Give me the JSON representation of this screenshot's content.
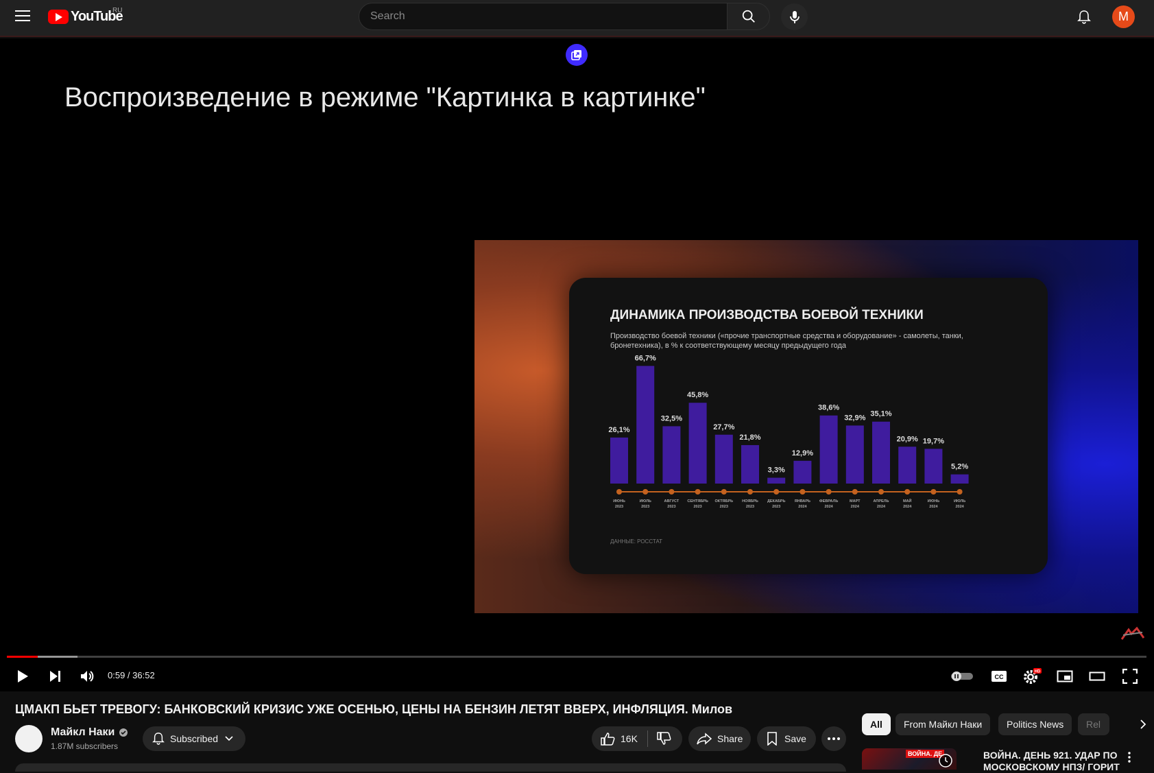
{
  "header": {
    "logo_text": "YouTube",
    "region": "RU",
    "search_placeholder": "Search",
    "avatar_letter": "M"
  },
  "player": {
    "pip_message": "Воспроизведение в режиме \"Картинка в картинке\"",
    "time_display": "0:59 / 36:52",
    "progress_played_fraction": 0.027,
    "progress_loaded_fraction": 0.062
  },
  "slide": {
    "title": "ДИНАМИКА ПРОИЗВОДСТВА БОЕВОЙ ТЕХНИКИ",
    "subtitle": "Производство боевой техники («прочие транспортные средства и оборудование» - самолеты, танки, бронетехника), в % к соответствующему месяцу предыдущего года",
    "source": "ДАННЫЕ: РОССТАТ"
  },
  "chart_data": {
    "type": "bar",
    "title": "ДИНАМИКА ПРОИЗВОДСТВА БОЕВОЙ ТЕХНИКИ",
    "categories": [
      "ИЮНЬ 2023",
      "ИЮЛЬ 2023",
      "АВГУСТ 2023",
      "СЕНТЯБРЬ 2023",
      "ОКТЯБРЬ 2023",
      "НОЯБРЬ 2023",
      "ДЕКАБРЬ 2023",
      "ЯНВАРЬ 2024",
      "ФЕВРАЛЬ 2024",
      "МАРТ 2024",
      "АПРЕЛЬ 2024",
      "МАЙ 2024",
      "ИЮНЬ 2024",
      "ИЮЛЬ 2024"
    ],
    "month_labels": [
      "ИЮНЬ",
      "ИЮЛЬ",
      "АВГУСТ",
      "СЕНТЯБРЬ",
      "ОКТЯБРЬ",
      "НОЯБРЬ",
      "ДЕКАБРЬ",
      "ЯНВАРЬ",
      "ФЕВРАЛЬ",
      "МАРТ",
      "АПРЕЛЬ",
      "МАЙ",
      "ИЮНЬ",
      "ИЮЛЬ"
    ],
    "year_labels": [
      "2023",
      "2023",
      "2023",
      "2023",
      "2023",
      "2023",
      "2023",
      "2024",
      "2024",
      "2024",
      "2024",
      "2024",
      "2024",
      "2024"
    ],
    "values": [
      26.1,
      66.7,
      32.5,
      45.8,
      27.7,
      21.8,
      3.3,
      12.9,
      38.6,
      32.9,
      35.1,
      20.9,
      19.7,
      5.2
    ],
    "value_labels": [
      "26,1%",
      "66,7%",
      "32,5%",
      "45,8%",
      "27,7%",
      "21,8%",
      "3,3%",
      "12,9%",
      "38,6%",
      "32,9%",
      "35,1%",
      "20,9%",
      "19,7%",
      "5,2%"
    ],
    "ylim": [
      0,
      70
    ],
    "bar_color": "#3f1c9e",
    "axis_color": "#c4621f",
    "grid": false
  },
  "video": {
    "title": "ЦМАКП БЬЕТ ТРЕВОГУ: БАНКОВСКИЙ КРИЗИС УЖЕ ОСЕНЬЮ, ЦЕНЫ НА БЕНЗИН ЛЕТЯТ ВВЕРХ, ИНФЛЯЦИЯ. Милов",
    "channel_name": "Майкл Наки",
    "subscribers": "1.87M subscribers",
    "subscribed_label": "Subscribed",
    "likes": "16K",
    "share_label": "Share",
    "save_label": "Save"
  },
  "chips": [
    "All",
    "From Майкл Наки",
    "Politics News",
    "Rel"
  ],
  "recommendation": {
    "badge": "ВОЙНА. ДЕ",
    "title": "ВОЙНА. ДЕНЬ 921. УДАР ПО МОСКОВСКОМУ НПЗ/ ГОРИТ"
  },
  "colors": {
    "accent_red": "#ff0000",
    "pip_badge": "#3f2bff",
    "avatar": "#e64a19"
  }
}
